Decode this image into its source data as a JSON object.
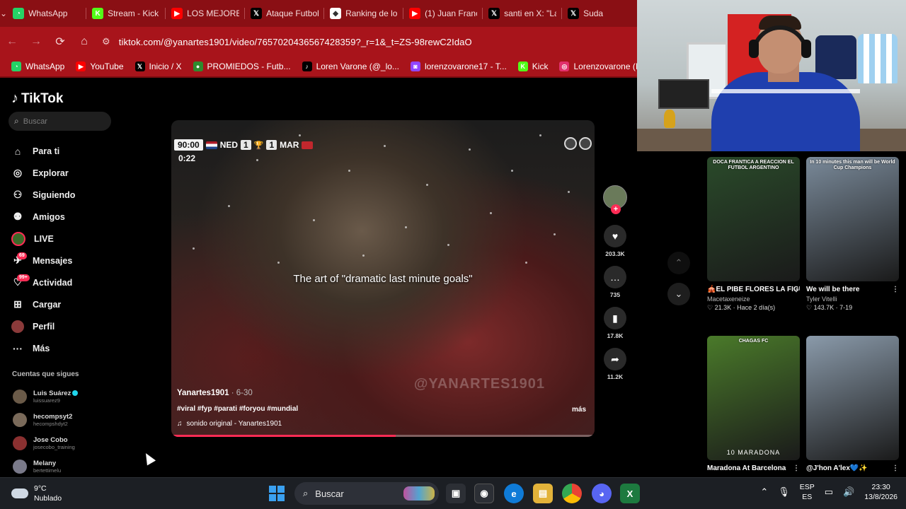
{
  "browser": {
    "tabs": [
      {
        "label": "WhatsApp",
        "icon": "whatsapp-icon",
        "color": "#25d366"
      },
      {
        "label": "Stream - Kick",
        "icon": "kick-icon",
        "color": "#53fc18"
      },
      {
        "label": "LOS MEJORES",
        "icon": "youtube-icon",
        "color": "#ff0000"
      },
      {
        "label": "Ataque Futbol",
        "icon": "x-icon",
        "color": "#000000"
      },
      {
        "label": "Ranking de lo",
        "icon": "diamond-icon",
        "color": "#ffffff"
      },
      {
        "label": "(1) Juan Franc",
        "icon": "youtube-icon",
        "color": "#ff0000"
      },
      {
        "label": "santi en X: \"La",
        "icon": "x-icon",
        "color": "#000000"
      },
      {
        "label": "Suda",
        "icon": "x-icon",
        "color": "#000000"
      }
    ],
    "url": "tiktok.com/@yanartes1901/video/7657020436567428359?_r=1&_t=ZS-98rewC2IdaO",
    "bookmarks": [
      {
        "label": "WhatsApp",
        "icon": "whatsapp-icon",
        "color": "#25d366"
      },
      {
        "label": "YouTube",
        "icon": "youtube-icon",
        "color": "#ff0000"
      },
      {
        "label": "Inicio / X",
        "icon": "x-icon",
        "color": "#000000"
      },
      {
        "label": "PROMIEDOS - Futb...",
        "icon": "promiedos-icon",
        "color": "#2e8b2e"
      },
      {
        "label": "Loren Varone (@_lo...",
        "icon": "tiktok-icon",
        "color": "#000000"
      },
      {
        "label": "lorenzovarone17 - T...",
        "icon": "twitch-icon",
        "color": "#9146ff"
      },
      {
        "label": "Kick",
        "icon": "kick-icon",
        "color": "#53fc18"
      },
      {
        "label": "Lorenzovarone (Inst...",
        "icon": "instagram-icon",
        "color": "#e1306c"
      }
    ]
  },
  "tiktok": {
    "brand": "TikTok",
    "search_placeholder": "Buscar",
    "nav": [
      {
        "label": "Para ti",
        "icon": "home-icon"
      },
      {
        "label": "Explorar",
        "icon": "compass-icon"
      },
      {
        "label": "Siguiendo",
        "icon": "following-icon"
      },
      {
        "label": "Amigos",
        "icon": "friends-icon"
      },
      {
        "label": "LIVE",
        "icon": "live-icon"
      },
      {
        "label": "Mensajes",
        "icon": "messages-icon",
        "badge": "69"
      },
      {
        "label": "Actividad",
        "icon": "activity-icon",
        "badge": "99+"
      },
      {
        "label": "Cargar",
        "icon": "upload-icon"
      },
      {
        "label": "Perfil",
        "icon": "profile-icon"
      },
      {
        "label": "Más",
        "icon": "more-icon"
      }
    ],
    "following_title": "Cuentas que sigues",
    "following": [
      {
        "name": "Luis Suárez",
        "user": "luissuarez9",
        "verified": true,
        "color": "#6a5a48"
      },
      {
        "name": "hecompsyt2",
        "user": "hecompshdyt2",
        "color": "#7a6a5a"
      },
      {
        "name": "Jose Cobo",
        "user": "josecobo_training",
        "color": "#8a3030"
      },
      {
        "name": "Melany",
        "user": "bertettimelu",
        "color": "#7a7a8a"
      }
    ],
    "video": {
      "clock": "90:00",
      "home_team": "NED",
      "home_score": "1",
      "away_score": "1",
      "away_team": "MAR",
      "timer": "0:22",
      "caption": "The art of \"dramatic last minute goals\"",
      "watermark": "@YANARTES1901",
      "author": "Yanartes1901",
      "date": "· 6-30",
      "tags": "#viral #fyp #parati #foryou #mundial",
      "more": "más",
      "sound": "sonido original - Yanartes1901",
      "progress": 0.53
    },
    "actions": [
      {
        "icon": "heart-icon",
        "count": "203.3K"
      },
      {
        "icon": "comment-icon",
        "count": "735"
      },
      {
        "icon": "bookmark-icon",
        "count": "17.8K"
      },
      {
        "icon": "share-icon",
        "count": "11.2K"
      }
    ],
    "suggested": [
      {
        "title": "🎪EL PIBE FLORES LA FIGURA Y JOYA DE...",
        "author": "Macetaxeneize",
        "meta": "♡ 21.3K · Hace 2 día(s)",
        "overlay": "DOCA FRANTICA A REACCION EL FUTBOL ARGENTINO",
        "bg": "#2a4a2a"
      },
      {
        "title": "We will be there",
        "author": "Tyler Vitelli",
        "meta": "♡ 143.7K · 7-19",
        "overlay": "In 10 minutes this man will be World Cup Champions",
        "bg": "#7a8a9a"
      },
      {
        "title": "Maradona At Barcelona",
        "author": "",
        "meta": "",
        "overlay": "CHAGAS FC",
        "bottom": "10 MARADONA",
        "bg": "#4a7a2a"
      },
      {
        "title": "@J'hon A'lex💙✨",
        "author": "",
        "meta": "",
        "overlay": "",
        "bg": "#8a9aaa"
      }
    ]
  },
  "taskbar": {
    "temp": "9°C",
    "weather": "Nublado",
    "search_label": "Buscar",
    "lang_top": "ESP",
    "lang_bottom": "ES",
    "time": "23:30",
    "date": "13/8/2026"
  }
}
